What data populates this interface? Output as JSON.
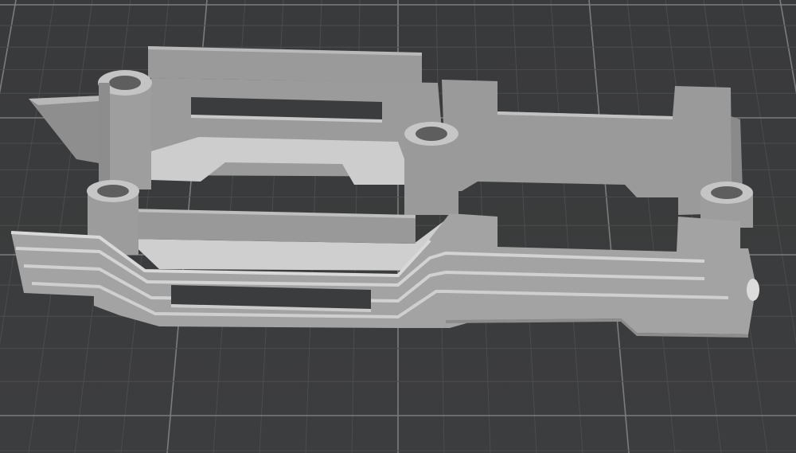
{
  "viewer": {
    "corner_text": "",
    "background_color": "#3a3b3c",
    "grid_minor_color": "#4a4c4e",
    "grid_major_color": "#7a7c7e",
    "model_color": "#a9a9a9"
  },
  "scene": {
    "description_icon": "3d-model-icon",
    "object": "printed-part-bracket"
  }
}
